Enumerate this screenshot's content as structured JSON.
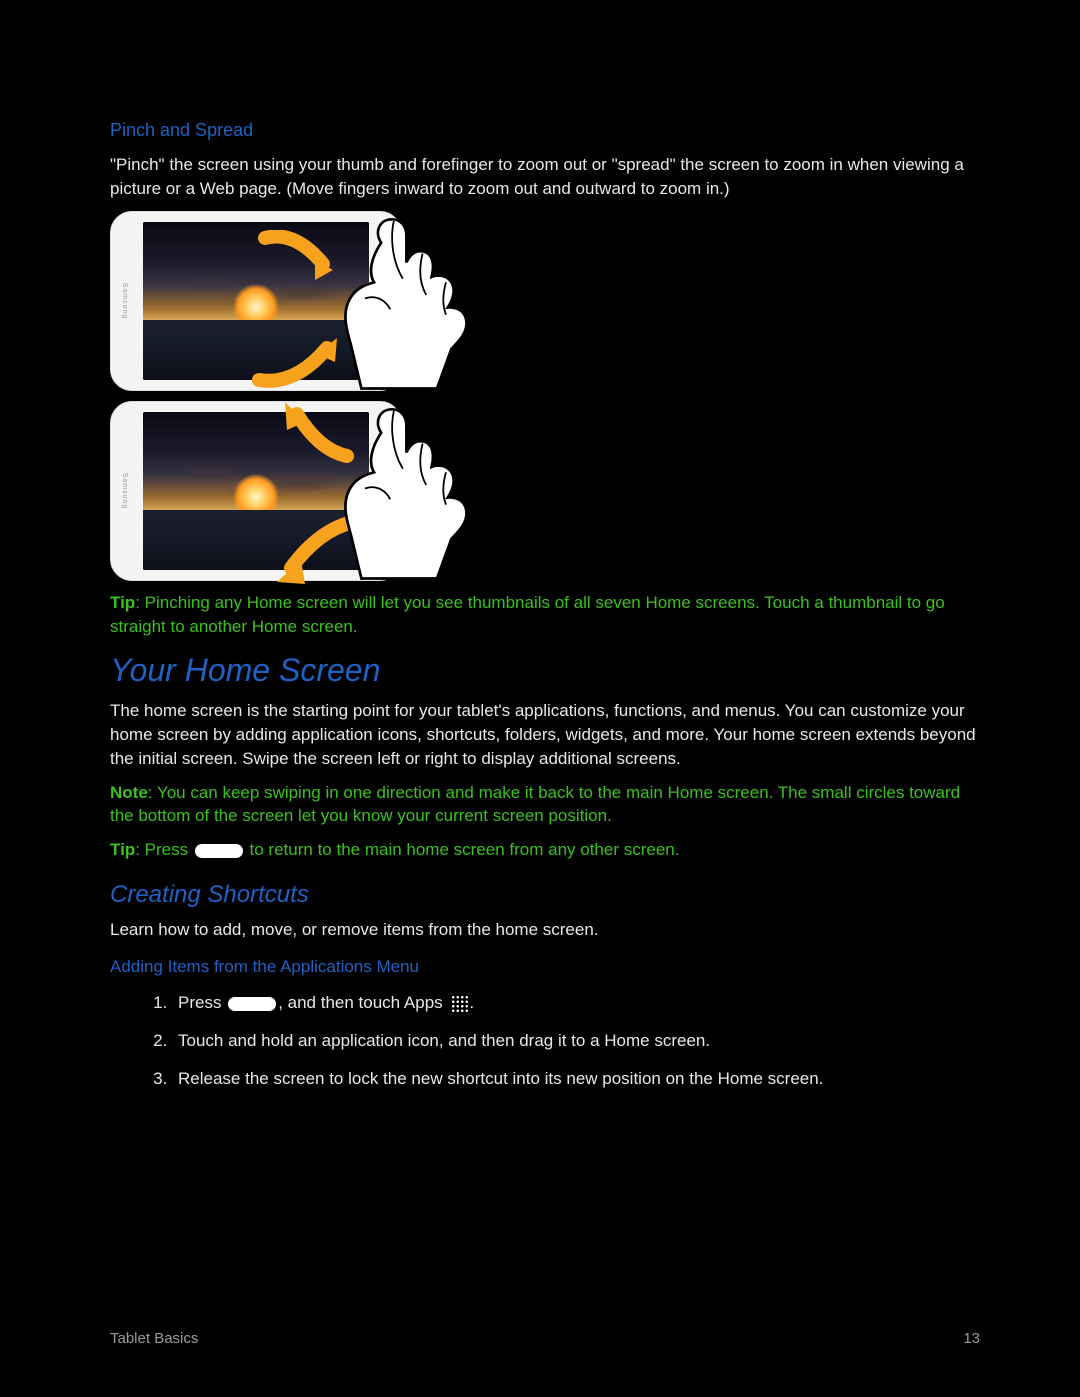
{
  "sections": {
    "pinch": {
      "heading": "Pinch and Spread",
      "body": "\"Pinch\" the screen using your thumb and forefinger to zoom out or \"spread\" the screen to zoom in when viewing a picture or a Web page. (Move fingers inward to zoom out and outward to zoom in.)",
      "tip_label": "Tip",
      "tip_text": ": Pinching any Home screen will let you see thumbnails of all seven Home screens. Touch a thumbnail to go straight to another Home screen."
    },
    "home": {
      "heading": "Your Home Screen",
      "body": "The home screen is the starting point for your tablet's applications, functions, and menus. You can customize your home screen by adding application icons, shortcuts, folders, widgets, and more. Your home screen extends beyond the initial screen. Swipe the screen left or right to display additional screens.",
      "note_label": "Note",
      "note_text": ": You can keep swiping in one direction and make it back to the main Home screen. The small circles toward the bottom of the screen let you know your current screen position.",
      "tip_label": "Tip",
      "tip_before": ": Press ",
      "tip_after": " to return to the main home screen from any other screen."
    },
    "shortcuts": {
      "heading": "Creating Shortcuts",
      "intro": "Learn how to add, move, or remove items from the home screen.",
      "sub": "Adding Items from the Applications Menu",
      "step1_before": "Press ",
      "step1_mid": ", and then touch ",
      "step1_bold": "Apps",
      "step2": "Touch and hold an application icon, and then drag it to a Home screen.",
      "step3": "Release the screen to lock the new shortcut into its new position on the Home screen."
    }
  },
  "footer": {
    "left": "Tablet Basics",
    "right": "13"
  }
}
